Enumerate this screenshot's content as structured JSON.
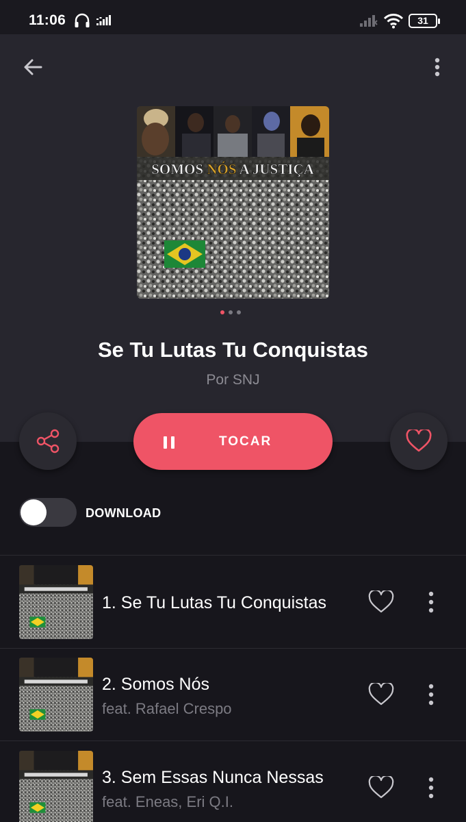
{
  "status_bar": {
    "time": "11:06",
    "battery": "31"
  },
  "header": {
    "back_icon": "arrow-left-icon",
    "menu_icon": "more-vertical-icon"
  },
  "album": {
    "cover_text_1": "SOMOS ",
    "cover_text_2": "NÓS",
    "cover_text_3": " A ",
    "cover_text_4": "JUSTIÇA",
    "title": "Se Tu Lutas Tu Conquistas",
    "artist": "Por SNJ",
    "carousel_pages": 3,
    "carousel_active": 0
  },
  "actions": {
    "play_label": "TOCAR",
    "share_icon": "share-icon",
    "favorite_icon": "heart-icon"
  },
  "download": {
    "label": "DOWNLOAD",
    "enabled": false
  },
  "tracks": [
    {
      "title": "1. Se Tu Lutas Tu Conquistas",
      "feat": ""
    },
    {
      "title": "2. Somos Nós",
      "feat": "feat. Rafael Crespo"
    },
    {
      "title": "3. Sem Essas Nunca Nessas",
      "feat": "feat. Eneas, Eri Q.I."
    }
  ],
  "colors": {
    "accent": "#ef5466",
    "header_bg": "#27262e",
    "page_bg": "#17161c"
  }
}
